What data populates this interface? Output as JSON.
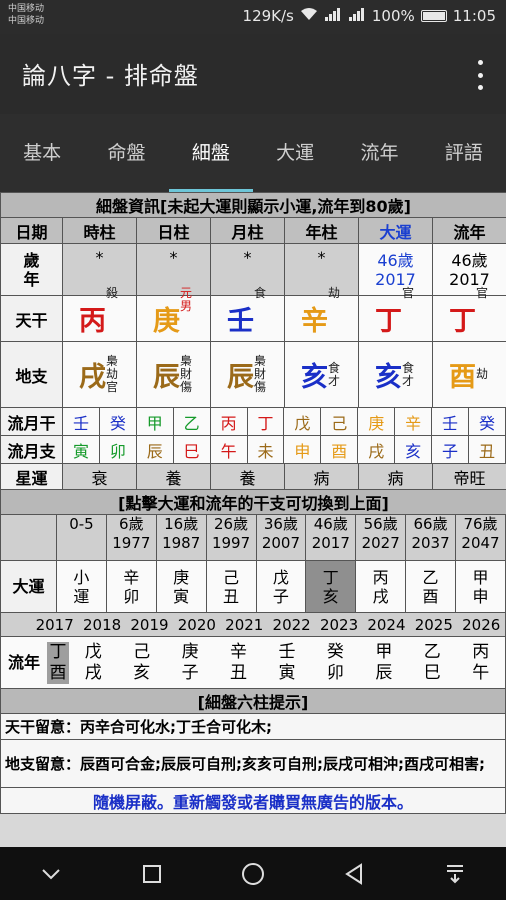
{
  "status": {
    "carrier1": "中国移动",
    "carrier2": "中国移动",
    "speed": "129K/s",
    "battery": "100%",
    "time": "11:05"
  },
  "app": {
    "title": "論八字 - 排命盤"
  },
  "tabs": [
    "基本",
    "命盤",
    "細盤",
    "大運",
    "流年",
    "評語"
  ],
  "detail": {
    "header": "細盤資訊[未起大運則顯示小運,流年到80歲]",
    "columns": [
      "日期",
      "時柱",
      "日柱",
      "月柱",
      "年柱",
      "大運",
      "流年"
    ],
    "age_label": "歲\n年",
    "age_cells": [
      "*",
      "*",
      "*",
      "*"
    ],
    "dayun_age": "46歲",
    "dayun_year": "2017",
    "liunian_age": "46歲",
    "liunian_year": "2017",
    "tiangan_label": "天干",
    "tiangan": [
      {
        "char": "丙",
        "note": "殺",
        "color": "#d41919"
      },
      {
        "char": "庚",
        "note": "元男",
        "color": "#e59a17"
      },
      {
        "char": "壬",
        "note": "食",
        "color": "#1a2fc7"
      },
      {
        "char": "辛",
        "note": "劫",
        "color": "#e59a17"
      },
      {
        "char": "丁",
        "note": "官",
        "color": "#d41919"
      },
      {
        "char": "丁",
        "note": "官",
        "color": "#d41919"
      }
    ],
    "dizhi_label": "地支",
    "dizhi": [
      {
        "char": "戌",
        "note": "梟劫官",
        "color": "#9b6a19"
      },
      {
        "char": "辰",
        "note": "梟財傷",
        "color": "#9b6a19"
      },
      {
        "char": "辰",
        "note": "梟財傷",
        "color": "#9b6a19"
      },
      {
        "char": "亥",
        "note": "食才",
        "color": "#1a2fc7"
      },
      {
        "char": "亥",
        "note": "食才",
        "color": "#1a2fc7"
      },
      {
        "char": "酉",
        "note": "劫",
        "color": "#e59a17"
      }
    ],
    "liuyue_gan_label": "流月干",
    "liuyue_gan": [
      {
        "c": "壬",
        "color": "#1a2fc7"
      },
      {
        "c": "癸",
        "color": "#1a2fc7"
      },
      {
        "c": "甲",
        "color": "#159a2a"
      },
      {
        "c": "乙",
        "color": "#159a2a"
      },
      {
        "c": "丙",
        "color": "#d41919"
      },
      {
        "c": "丁",
        "color": "#d41919"
      },
      {
        "c": "戊",
        "color": "#9b6a19"
      },
      {
        "c": "己",
        "color": "#9b6a19"
      },
      {
        "c": "庚",
        "color": "#e59a17"
      },
      {
        "c": "辛",
        "color": "#e59a17"
      },
      {
        "c": "壬",
        "color": "#1a2fc7"
      },
      {
        "c": "癸",
        "color": "#1a2fc7"
      }
    ],
    "liuyue_zhi_label": "流月支",
    "liuyue_zhi": [
      {
        "c": "寅",
        "color": "#159a2a"
      },
      {
        "c": "卯",
        "color": "#159a2a"
      },
      {
        "c": "辰",
        "color": "#9b6a19"
      },
      {
        "c": "巳",
        "color": "#d41919"
      },
      {
        "c": "午",
        "color": "#d41919"
      },
      {
        "c": "未",
        "color": "#9b6a19"
      },
      {
        "c": "申",
        "color": "#e59a17"
      },
      {
        "c": "酉",
        "color": "#e59a17"
      },
      {
        "c": "戌",
        "color": "#9b6a19"
      },
      {
        "c": "亥",
        "color": "#1a2fc7"
      },
      {
        "c": "子",
        "color": "#1a2fc7"
      },
      {
        "c": "丑",
        "color": "#9b6a19"
      }
    ],
    "xingyun_label": "星運",
    "xingyun": [
      "衰",
      "養",
      "養",
      "病",
      "病",
      "帝旺"
    ]
  },
  "switch_header": "[點擊大運和流年的干支可切換到上面]",
  "dayun_ages": [
    {
      "a": "0-5",
      "y": ""
    },
    {
      "a": "6歲",
      "y": "1977"
    },
    {
      "a": "16歲",
      "y": "1987"
    },
    {
      "a": "26歲",
      "y": "1997"
    },
    {
      "a": "36歲",
      "y": "2007"
    },
    {
      "a": "46歲",
      "y": "2017"
    },
    {
      "a": "56歲",
      "y": "2027"
    },
    {
      "a": "66歲",
      "y": "2037"
    },
    {
      "a": "76歲",
      "y": "2047"
    }
  ],
  "dayun_label": "大運",
  "dayun": [
    {
      "g": "小",
      "z": "運"
    },
    {
      "g": "辛",
      "z": "卯"
    },
    {
      "g": "庚",
      "z": "寅"
    },
    {
      "g": "己",
      "z": "丑"
    },
    {
      "g": "戊",
      "z": "子"
    },
    {
      "g": "丁",
      "z": "亥"
    },
    {
      "g": "丙",
      "z": "戌"
    },
    {
      "g": "乙",
      "z": "酉"
    },
    {
      "g": "甲",
      "z": "申"
    }
  ],
  "liunian_years": [
    "2017",
    "2018",
    "2019",
    "2020",
    "2021",
    "2022",
    "2023",
    "2024",
    "2025",
    "2026"
  ],
  "liunian_label": "流年",
  "liunian": [
    {
      "g": "丁",
      "z": "酉"
    },
    {
      "g": "戊",
      "z": "戌"
    },
    {
      "g": "己",
      "z": "亥"
    },
    {
      "g": "庚",
      "z": "子"
    },
    {
      "g": "辛",
      "z": "丑"
    },
    {
      "g": "壬",
      "z": "寅"
    },
    {
      "g": "癸",
      "z": "卯"
    },
    {
      "g": "甲",
      "z": "辰"
    },
    {
      "g": "乙",
      "z": "巳"
    },
    {
      "g": "丙",
      "z": "午"
    }
  ],
  "hint_header": "[細盤六柱提示]",
  "tiangan_note_label": "天干留意：",
  "tiangan_note": "丙辛合可化水;丁壬合可化木;",
  "dizhi_note_label": "地支留意：",
  "dizhi_note": "辰酉可合金;辰辰可自刑;亥亥可自刑;辰戌可相沖;酉戌可相害;",
  "ad_note": "隨機屏蔽。重新觸發或者購買無廣告的版本。"
}
